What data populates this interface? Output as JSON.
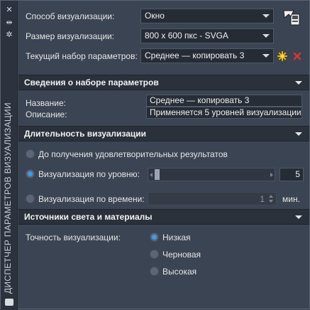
{
  "window": {
    "side_title": "ДИСПЕТЧЕР ПАРАМЕТРОВ ВИЗУАЛИЗАЦИИ",
    "controls": {
      "close": "✕",
      "autohide": "⇹",
      "properties": "✲"
    }
  },
  "header": {
    "render_mode_label": "Способ визуализации:",
    "render_mode_value": "Окно",
    "render_size_label": "Размер визуализации:",
    "render_size_value": "800 x 600 пкс - SVGA",
    "current_preset_label": "Текущий набор параметров:",
    "current_preset_value": "Среднее — копировать 3"
  },
  "preset_info": {
    "section_title": "Сведения о наборе параметров",
    "name_label": "Название:",
    "name_value": "Среднее — копировать 3",
    "description_label": "Описание:",
    "description_value": "Применяется 5 уровней визуализации"
  },
  "duration": {
    "section_title": "Длительность визуализации",
    "option_until_satisfactory": "До получения удовлетворительных результатов",
    "option_by_level": "Визуализация по уровню:",
    "level_value": "5",
    "level_fraction": 0.05,
    "option_by_time": "Визуализация по времени:",
    "time_value": "1",
    "time_unit": "мин.",
    "selected": "by_level"
  },
  "lights": {
    "section_title": "Источники света и материалы",
    "accuracy_label": "Точность визуализации:",
    "option_low": "Низкая",
    "option_draft": "Черновая",
    "option_high": "Высокая",
    "selected": "low"
  },
  "colors": {
    "accent": "#3d9bea",
    "new_icon": "#f0b400",
    "delete_icon": "#e0342b"
  }
}
